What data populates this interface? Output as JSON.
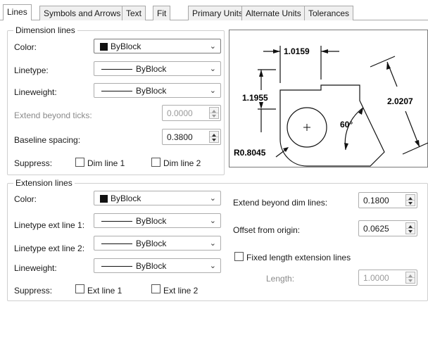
{
  "tabs": [
    "Lines",
    "Symbols and Arrows",
    "Text",
    "Fit",
    "Primary Units",
    "Alternate Units",
    "Tolerances"
  ],
  "dimension_lines": {
    "title": "Dimension lines",
    "color_label": "Color:",
    "color_value": "ByBlock",
    "linetype_label": "Linetype:",
    "linetype_value": "ByBlock",
    "lineweight_label": "Lineweight:",
    "lineweight_value": "ByBlock",
    "extend_label": "Extend beyond ticks:",
    "extend_value": "0.0000",
    "baseline_label": "Baseline spacing:",
    "baseline_value": "0.3800",
    "suppress_label": "Suppress:",
    "dim1_label": "Dim line 1",
    "dim2_label": "Dim line 2"
  },
  "preview": {
    "dim_top": "1.0159",
    "dim_left": "1.1955",
    "dim_right": "2.0207",
    "angle": "60°",
    "radius": "R0.8045"
  },
  "extension_lines": {
    "title": "Extension lines",
    "color_label": "Color:",
    "color_value": "ByBlock",
    "linetype1_label": "Linetype ext line 1:",
    "linetype1_value": "ByBlock",
    "linetype2_label": "Linetype ext line 2:",
    "linetype2_value": "ByBlock",
    "lineweight_label": "Lineweight:",
    "lineweight_value": "ByBlock",
    "suppress_label": "Suppress:",
    "ext1_label": "Ext line 1",
    "ext2_label": "Ext line 2",
    "extend_dim_label": "Extend beyond dim lines:",
    "extend_dim_value": "0.1800",
    "offset_label": "Offset from origin:",
    "offset_value": "0.0625",
    "fixed_label": "Fixed length extension lines",
    "length_label": "Length:",
    "length_value": "1.0000"
  }
}
